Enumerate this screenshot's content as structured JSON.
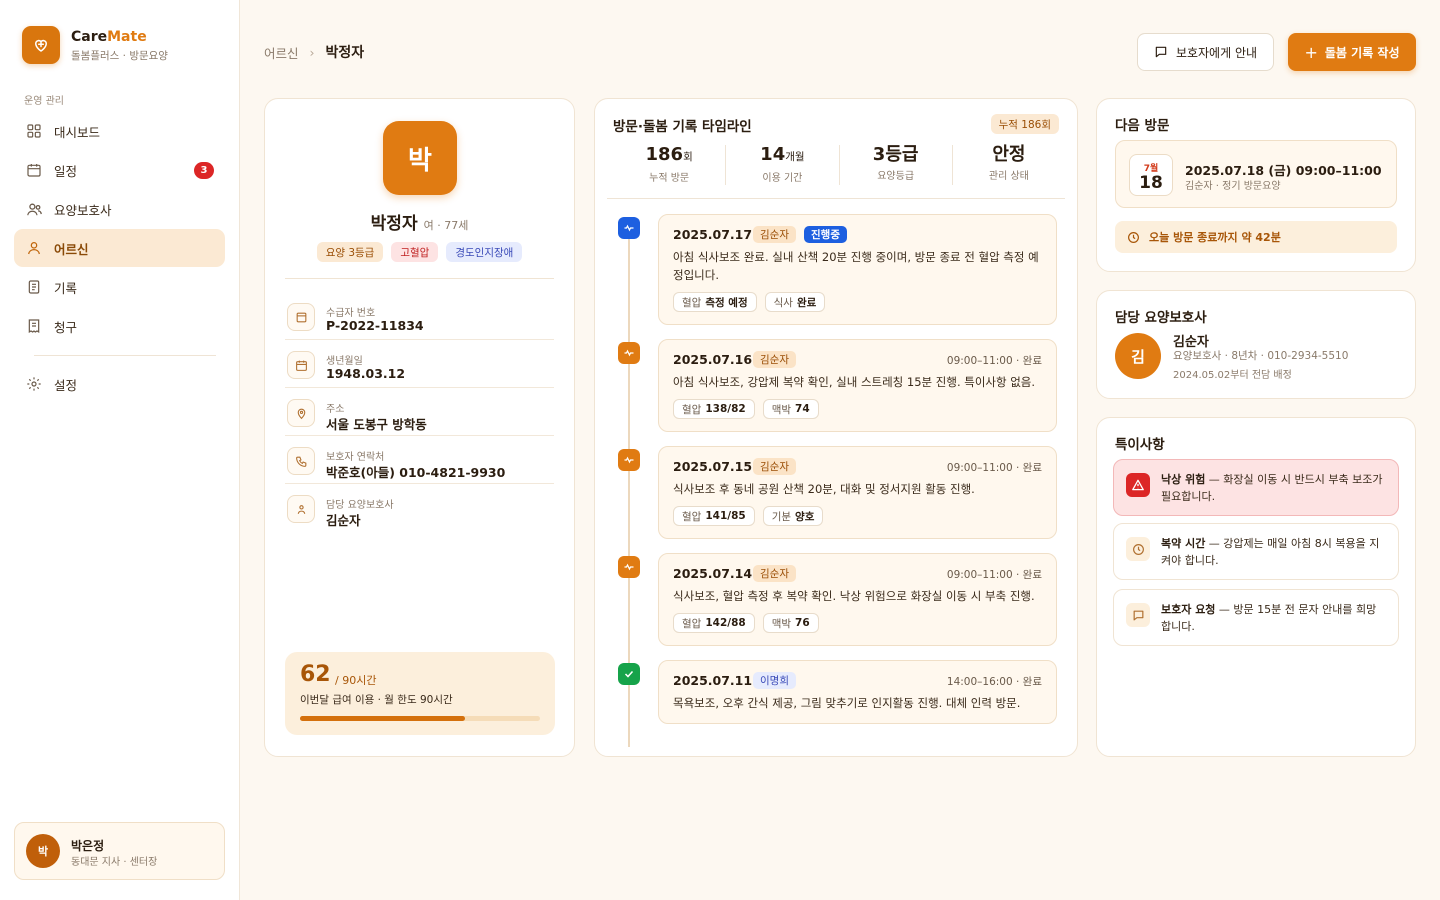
{
  "brand": {
    "name_main": "Care",
    "name_accent": "Mate",
    "subtitle": "돌봄플러스 · 방문요양",
    "logo_icon": "heart-icon"
  },
  "sidebar": {
    "section": "운영 관리",
    "items": [
      {
        "label": "대시보드",
        "icon": "grid-icon"
      },
      {
        "label": "일정",
        "icon": "calendar-icon",
        "badge": "3"
      },
      {
        "label": "요양보호사",
        "icon": "users-icon"
      },
      {
        "label": "어르신",
        "icon": "user-icon",
        "active": true
      },
      {
        "label": "기록",
        "icon": "document-icon"
      },
      {
        "label": "청구",
        "icon": "receipt-icon"
      },
      {
        "label": "설정",
        "icon": "gear-icon"
      }
    ],
    "user": {
      "initial": "박",
      "name": "박은정",
      "sub": "동대문 지사 · 센터장"
    }
  },
  "header": {
    "breadcrumb_root": "어르신",
    "breadcrumb_current": "박정자",
    "btn_guardian": "보호자에게 안내",
    "btn_write": "돌봄 기록 작성"
  },
  "profile": {
    "initial": "박",
    "name": "박정자",
    "meta": "여 · 77세",
    "tags": [
      "요양 3등급",
      "고혈압",
      "경도인지장애"
    ],
    "info": [
      {
        "label": "수급자 번호",
        "value": "P-2022-11834",
        "icon": "id-card-icon"
      },
      {
        "label": "생년월일",
        "value": "1948.03.12",
        "icon": "calendar-icon"
      },
      {
        "label": "주소",
        "value": "서울 도봉구 방학동",
        "icon": "location-pin-icon"
      },
      {
        "label": "보호자 연락처",
        "value": "박준호(아들) 010-4821-9930",
        "icon": "phone-icon"
      },
      {
        "label": "담당 요양보호사",
        "value": "김순자",
        "icon": "person-icon"
      }
    ],
    "usage": {
      "used": "62",
      "total": " / 90시간",
      "label": "이번달 급여 이용 · 월 한도 90시간",
      "progress": 0.689
    }
  },
  "timeline": {
    "title": "방문·돌봄 기록 타임라인",
    "count": "누적 186회",
    "stats": [
      {
        "value": "186",
        "unit": "회",
        "label": "누적 방문"
      },
      {
        "value": "14",
        "unit": "개월",
        "label": "이용 기간"
      },
      {
        "value": "3등급",
        "unit": "",
        "label": "요양등급"
      },
      {
        "value": "안정",
        "unit": "",
        "label": "관리 상태"
      }
    ],
    "entries": [
      {
        "date": "2025.07.17",
        "caregiver": "김순자",
        "status": "진행중",
        "time": "",
        "text": "아침 식사보조 완료. 실내 산책 20분 진행 중이며, 방문 종료 전 혈압 측정 예정입니다.",
        "chips": [
          {
            "k": "혈압",
            "v": "측정 예정"
          },
          {
            "k": "식사",
            "v": "완료"
          }
        ],
        "dot": "blue"
      },
      {
        "date": "2025.07.16",
        "caregiver": "김순자",
        "status": "",
        "time": "09:00–11:00 · 완료",
        "text": "아침 식사보조, 강압제 복약 확인, 실내 스트레칭 15분 진행. 특이사항 없음.",
        "chips": [
          {
            "k": "혈압",
            "v": "138/82"
          },
          {
            "k": "맥박",
            "v": "74"
          }
        ],
        "dot": "orange"
      },
      {
        "date": "2025.07.15",
        "caregiver": "김순자",
        "status": "",
        "time": "09:00–11:00 · 완료",
        "text": "식사보조 후 동네 공원 산책 20분, 대화 및 정서지원 활동 진행.",
        "chips": [
          {
            "k": "혈압",
            "v": "141/85"
          },
          {
            "k": "기분",
            "v": "양호"
          }
        ],
        "dot": "orange"
      },
      {
        "date": "2025.07.14",
        "caregiver": "김순자",
        "status": "",
        "time": "09:00–11:00 · 완료",
        "text": "식사보조, 혈압 측정 후 복약 확인. 낙상 위험으로 화장실 이동 시 부축 진행.",
        "chips": [
          {
            "k": "혈압",
            "v": "142/88"
          },
          {
            "k": "맥박",
            "v": "76"
          }
        ],
        "dot": "orange"
      },
      {
        "date": "2025.07.11",
        "caregiver": "이명희",
        "status": "",
        "time": "14:00–16:00 · 완료",
        "text": "목욕보조, 오후 간식 제공, 그림 맞추기로 인지활동 진행. 대체 인력 방문.",
        "chips": [],
        "dot": "green"
      }
    ]
  },
  "next_visit": {
    "title": "다음 방문",
    "month": "7월",
    "day": "18",
    "datetime": "2025.07.18 (금) 09:00–11:00",
    "sub": "김순자 · 정기 방문요양",
    "alert": "오늘 방문 종료까지 약 42분"
  },
  "caregiver": {
    "title": "담당 요양보호사",
    "initial": "김",
    "name": "김순자",
    "sub": "요양보호사 · 8년차 · 010-2934-5510",
    "since": "2024.05.02부터 전담 배정"
  },
  "notes": {
    "title": "특이사항",
    "items": [
      {
        "head": "낙상 위험",
        "body": " — 화장실 이동 시 반드시 부축 보조가 필요합니다.",
        "icon": "warning-icon"
      },
      {
        "head": "복약 시간",
        "body": " — 강압제는 매일 아침 8시 복용을 지켜야 합니다.",
        "icon": "clock-icon"
      },
      {
        "head": "보호자 요청",
        "body": " — 방문 15분 전 문자 안내를 희망합니다.",
        "icon": "message-icon"
      }
    ]
  },
  "colors": {
    "accent": "#e07b12",
    "accent_dark": "#a85608",
    "danger": "#dc2626",
    "live": "#1d5fe0",
    "success": "#16a34a"
  }
}
